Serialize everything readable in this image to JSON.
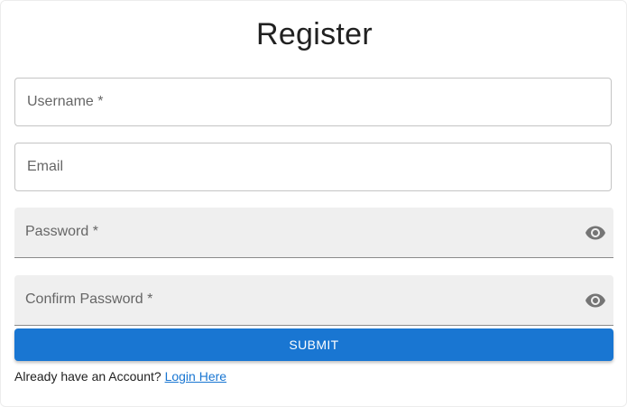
{
  "form": {
    "title": "Register",
    "fields": {
      "username": {
        "label": "Username *"
      },
      "email": {
        "label": "Email"
      },
      "password": {
        "label": "Password *",
        "icon": "eye-icon"
      },
      "confirm_password": {
        "label": "Confirm Password *",
        "icon": "eye-icon"
      }
    },
    "submit_label": "SUBMIT",
    "footer": {
      "text": "Already have an Account?",
      "link_label": "Login Here"
    }
  },
  "colors": {
    "primary": "#1976d2",
    "filled_bg": "#efefef",
    "outline": "#c4c4c4"
  }
}
